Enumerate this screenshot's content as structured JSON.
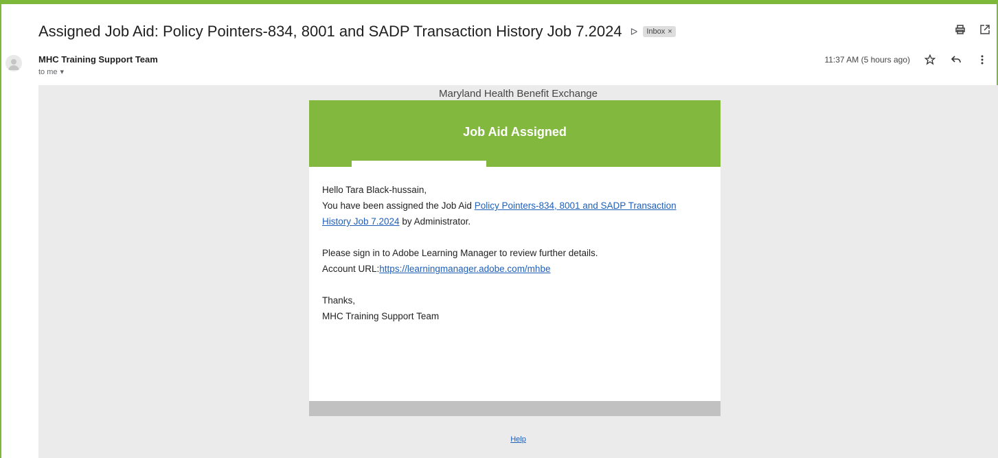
{
  "email": {
    "subject": "Assigned Job Aid: Policy Pointers-834, 8001 and SADP Transaction History Job 7.2024",
    "label_chip": "Inbox",
    "sender_name": "MHC Training Support Team",
    "recipient": "to me",
    "timestamp": "11:37 AM (5 hours ago)"
  },
  "message": {
    "org_name": "Maryland Health Benefit Exchange",
    "header_title": "Job Aid Assigned",
    "greeting": "Hello Tara Black-hussain,",
    "assigned_prefix": "You have been assigned the Job Aid ",
    "job_aid_link": "Policy Pointers-834, 8001 and SADP Transaction History Job 7.2024",
    "assigned_suffix": " by Administrator.",
    "instruction": "Please sign in to Adobe Learning Manager to review further details.",
    "account_prefix": "Account URL:",
    "account_url": "https://learningmanager.adobe.com/mhbe",
    "thanks": "Thanks,",
    "signature": "MHC Training Support Team",
    "help_link": "Help"
  },
  "icons": {
    "important": "important-marker-icon",
    "chip_close": "close-icon",
    "print": "print-icon",
    "open_new": "open-in-new-window-icon",
    "avatar": "avatar-icon",
    "dropdown": "chevron-down-icon",
    "star": "star-icon",
    "reply": "reply-icon",
    "more": "more-vert-icon"
  },
  "colors": {
    "frame_border": "#7db83a",
    "header_bg": "#83b83f",
    "link": "#1f5fb8",
    "body_bg": "#ebebeb",
    "footer_bar": "#c1c1c1"
  }
}
